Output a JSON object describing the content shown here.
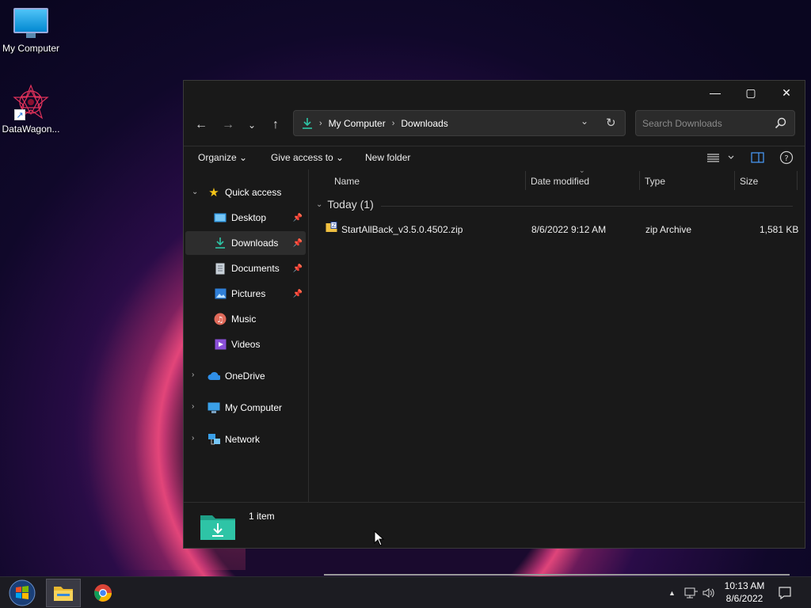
{
  "desktop": {
    "icons": [
      {
        "label": "My Computer"
      },
      {
        "label": "DataWagon..."
      }
    ]
  },
  "window": {
    "title_buttons": {
      "minimize": "—",
      "maximize": "▢",
      "close": "✕"
    },
    "nav": {
      "back": "←",
      "forward": "→",
      "recent": "⌄",
      "up": "↑"
    },
    "address": {
      "segments": [
        "My Computer",
        "Downloads"
      ],
      "sep": "›",
      "dropdown": "⌄",
      "refresh": "↻"
    },
    "search": {
      "placeholder": "Search Downloads"
    },
    "commands": {
      "organize": "Organize ⌄",
      "give_access": "Give access to ⌄",
      "new_folder": "New folder"
    },
    "sidebar": {
      "quick_access": "Quick access",
      "items": [
        {
          "label": "Desktop",
          "pinned": true
        },
        {
          "label": "Downloads",
          "pinned": true,
          "selected": true
        },
        {
          "label": "Documents",
          "pinned": true
        },
        {
          "label": "Pictures",
          "pinned": true
        },
        {
          "label": "Music"
        },
        {
          "label": "Videos"
        }
      ],
      "roots": [
        {
          "label": "OneDrive"
        },
        {
          "label": "My Computer"
        },
        {
          "label": "Network"
        }
      ]
    },
    "columns": [
      "Name",
      "Date modified",
      "Type",
      "Size"
    ],
    "groups": [
      {
        "label": "Today (1)",
        "files": [
          {
            "name": "StartAllBack_v3.5.0.4502.zip",
            "date": "8/6/2022 9:12 AM",
            "type": "zip Archive",
            "size": "1,581 KB"
          }
        ]
      }
    ],
    "status": {
      "count": "1 item"
    }
  },
  "taskbar": {
    "clock_time": "10:13 AM",
    "clock_date": "8/6/2022",
    "tray_chevron": "▲"
  },
  "colors": {
    "accent": "#2ec4a6",
    "window_bg": "#191919",
    "star": "#f5c518"
  }
}
